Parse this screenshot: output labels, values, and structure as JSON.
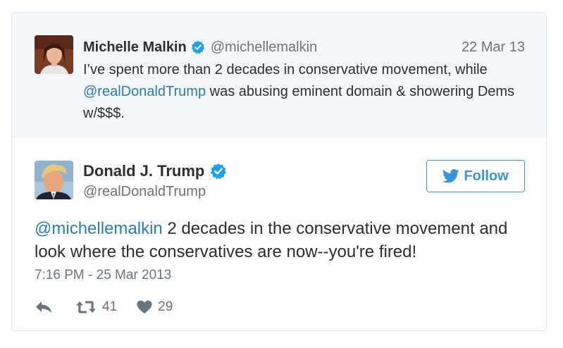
{
  "quoted": {
    "author_name": "Michelle Malkin",
    "author_handle": "@michellemalkin",
    "date": "22 Mar 13",
    "text_part1": "I’ve spent more than 2 decades in conservative movement, while ",
    "mention": "@realDonaldTrump",
    "text_part2": " was abusing eminent domain & showering Dems w/$$$."
  },
  "tweet": {
    "author_name": "Donald J. Trump",
    "author_handle": "@realDonaldTrump",
    "follow_label": "Follow",
    "mention": "@michellemalkin",
    "text": " 2 decades in the conservative movement and look where the conservatives are now--you're fired!",
    "timestamp": "7:16 PM - 25 Mar 2013",
    "retweet_count": "41",
    "like_count": "29"
  },
  "colors": {
    "link": "#2b7bb9",
    "verified": "#1da1f2",
    "follow": "#3b94d9",
    "muted": "#66757f",
    "quoted_bg": "#f5f8fa"
  },
  "icons": {
    "verified": "verified-badge-icon",
    "follow": "twitter-bird-icon",
    "reply": "reply-icon",
    "retweet": "retweet-icon",
    "like": "heart-icon"
  }
}
